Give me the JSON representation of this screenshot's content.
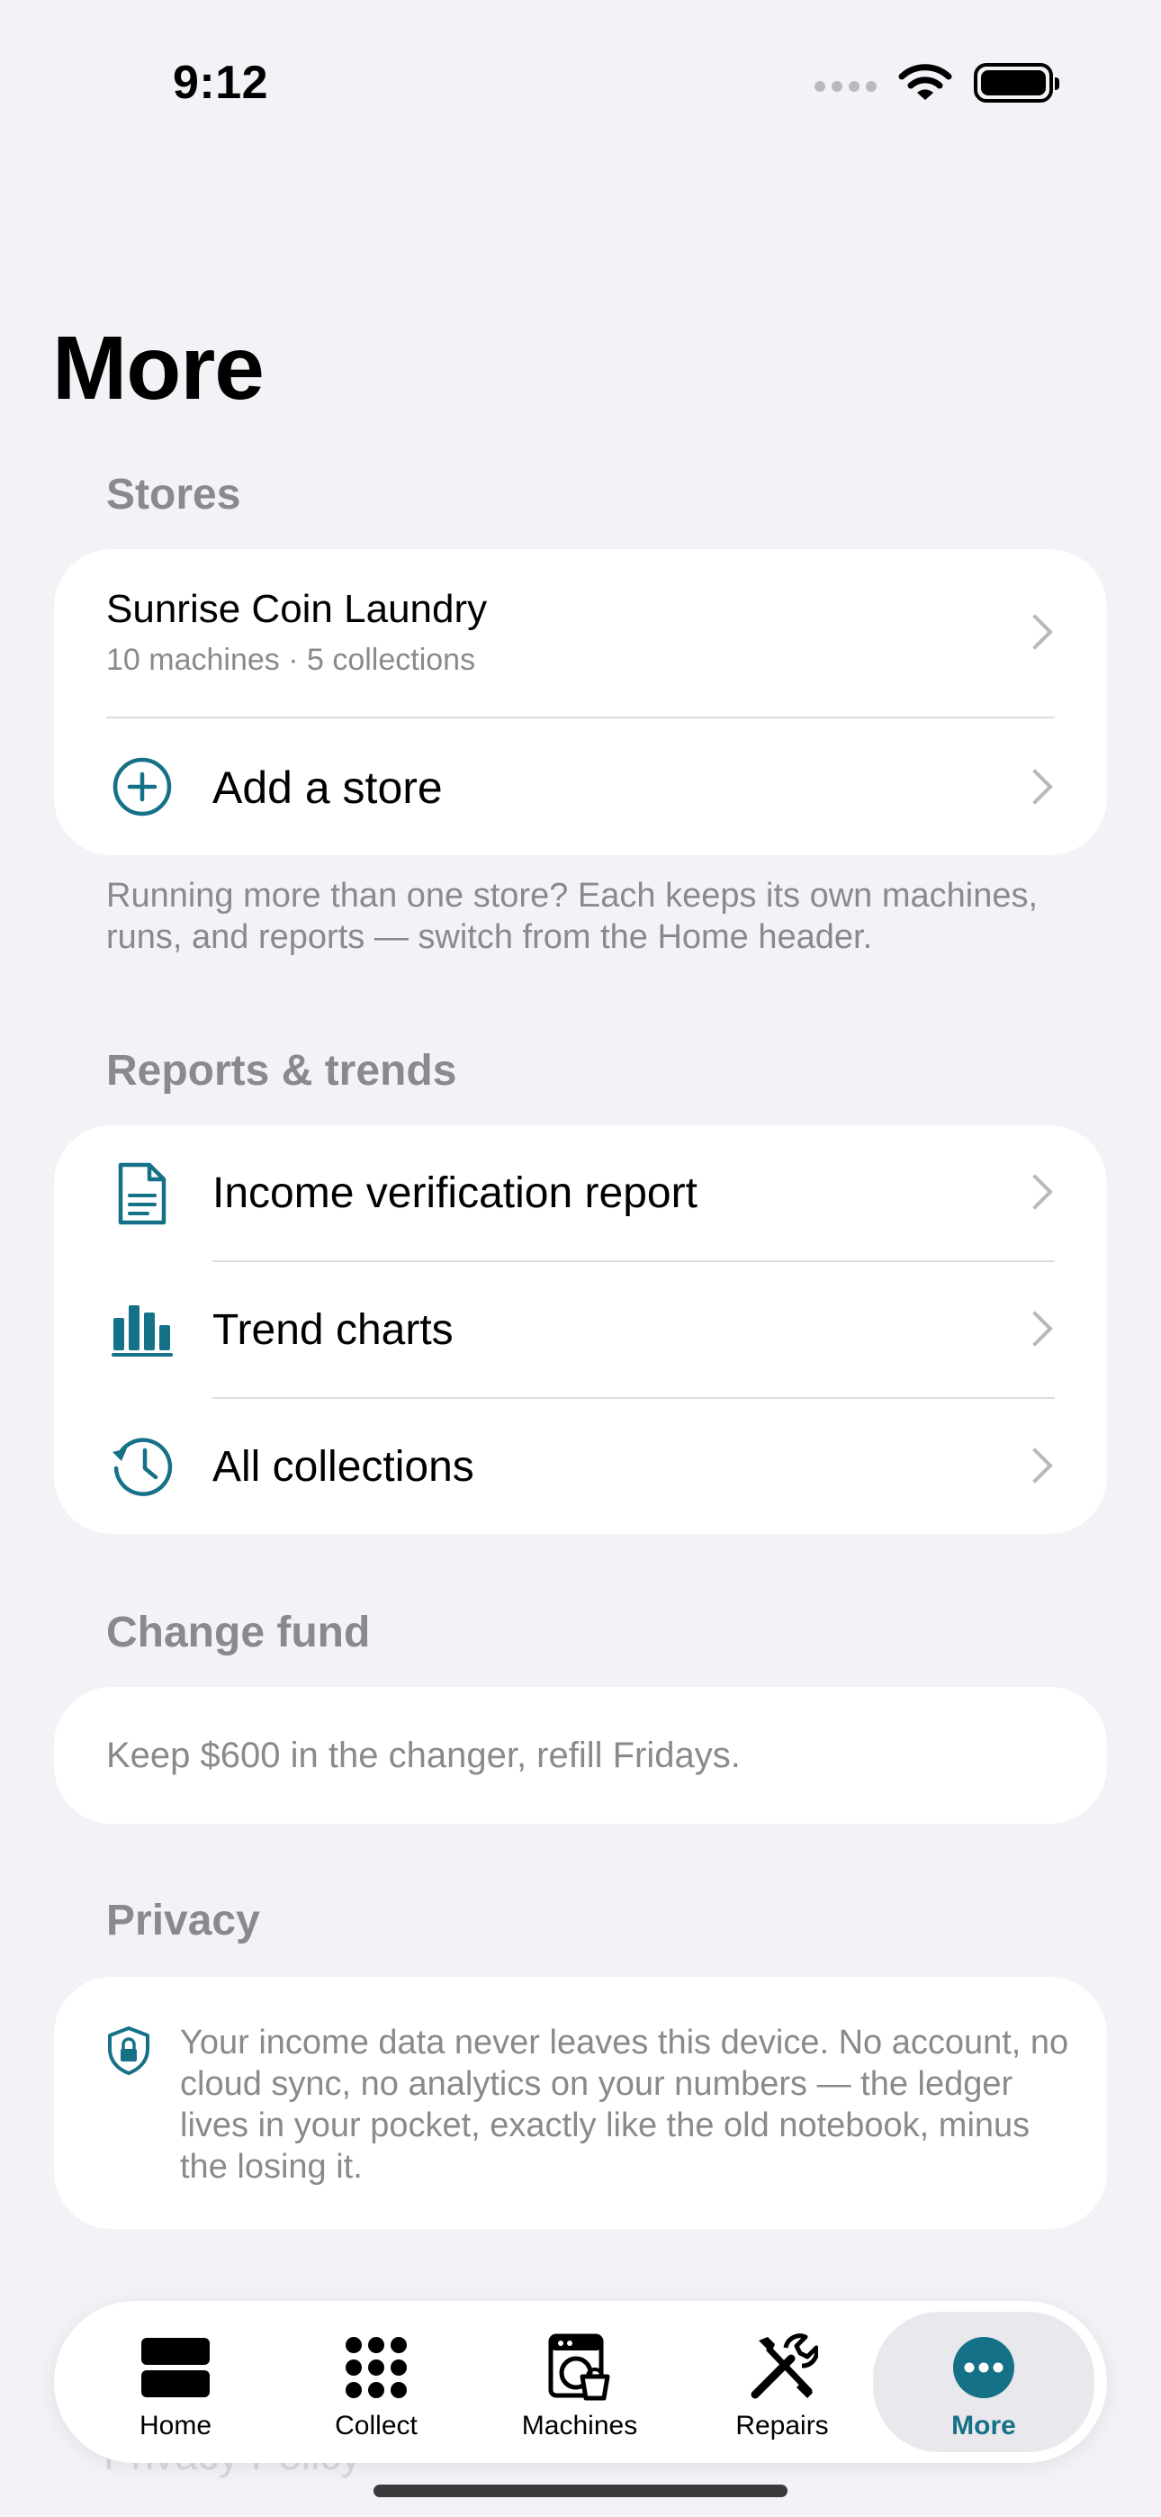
{
  "status": {
    "time": "9:12"
  },
  "page": {
    "title": "More"
  },
  "stores": {
    "header": "Stores",
    "store": {
      "name": "Sunrise Coin Laundry",
      "subtitle": "10 machines · 5 collections"
    },
    "add_label": "Add a store",
    "footnote": "Running more than one store? Each keeps its own machines, runs, and reports — switch from the Home header."
  },
  "reports": {
    "header": "Reports & trends",
    "items": [
      {
        "label": "Income verification report",
        "icon": "document-icon"
      },
      {
        "label": "Trend charts",
        "icon": "bar-chart-icon"
      },
      {
        "label": "All collections",
        "icon": "history-clock-icon"
      }
    ]
  },
  "change_fund": {
    "header": "Change fund",
    "note": "Keep $600 in the changer, refill Fridays."
  },
  "privacy": {
    "header": "Privacy",
    "text": "Your income data never leaves this device. No account, no cloud sync, no analytics on your numbers — the ledger lives in your pocket, exactly like the old notebook, minus the losing it.",
    "policy_label": "Privacy Policy"
  },
  "tabbar": {
    "tabs": [
      {
        "label": "Home",
        "icon": "home-icon"
      },
      {
        "label": "Collect",
        "icon": "grid-icon"
      },
      {
        "label": "Machines",
        "icon": "washing-machine-icon"
      },
      {
        "label": "Repairs",
        "icon": "wrench-screwdriver-icon"
      },
      {
        "label": "More",
        "icon": "more-icon"
      }
    ],
    "active": "More"
  },
  "colors": {
    "accent": "#157187",
    "background": "#f2f2f7",
    "secondary_text": "#8a8a8e"
  }
}
